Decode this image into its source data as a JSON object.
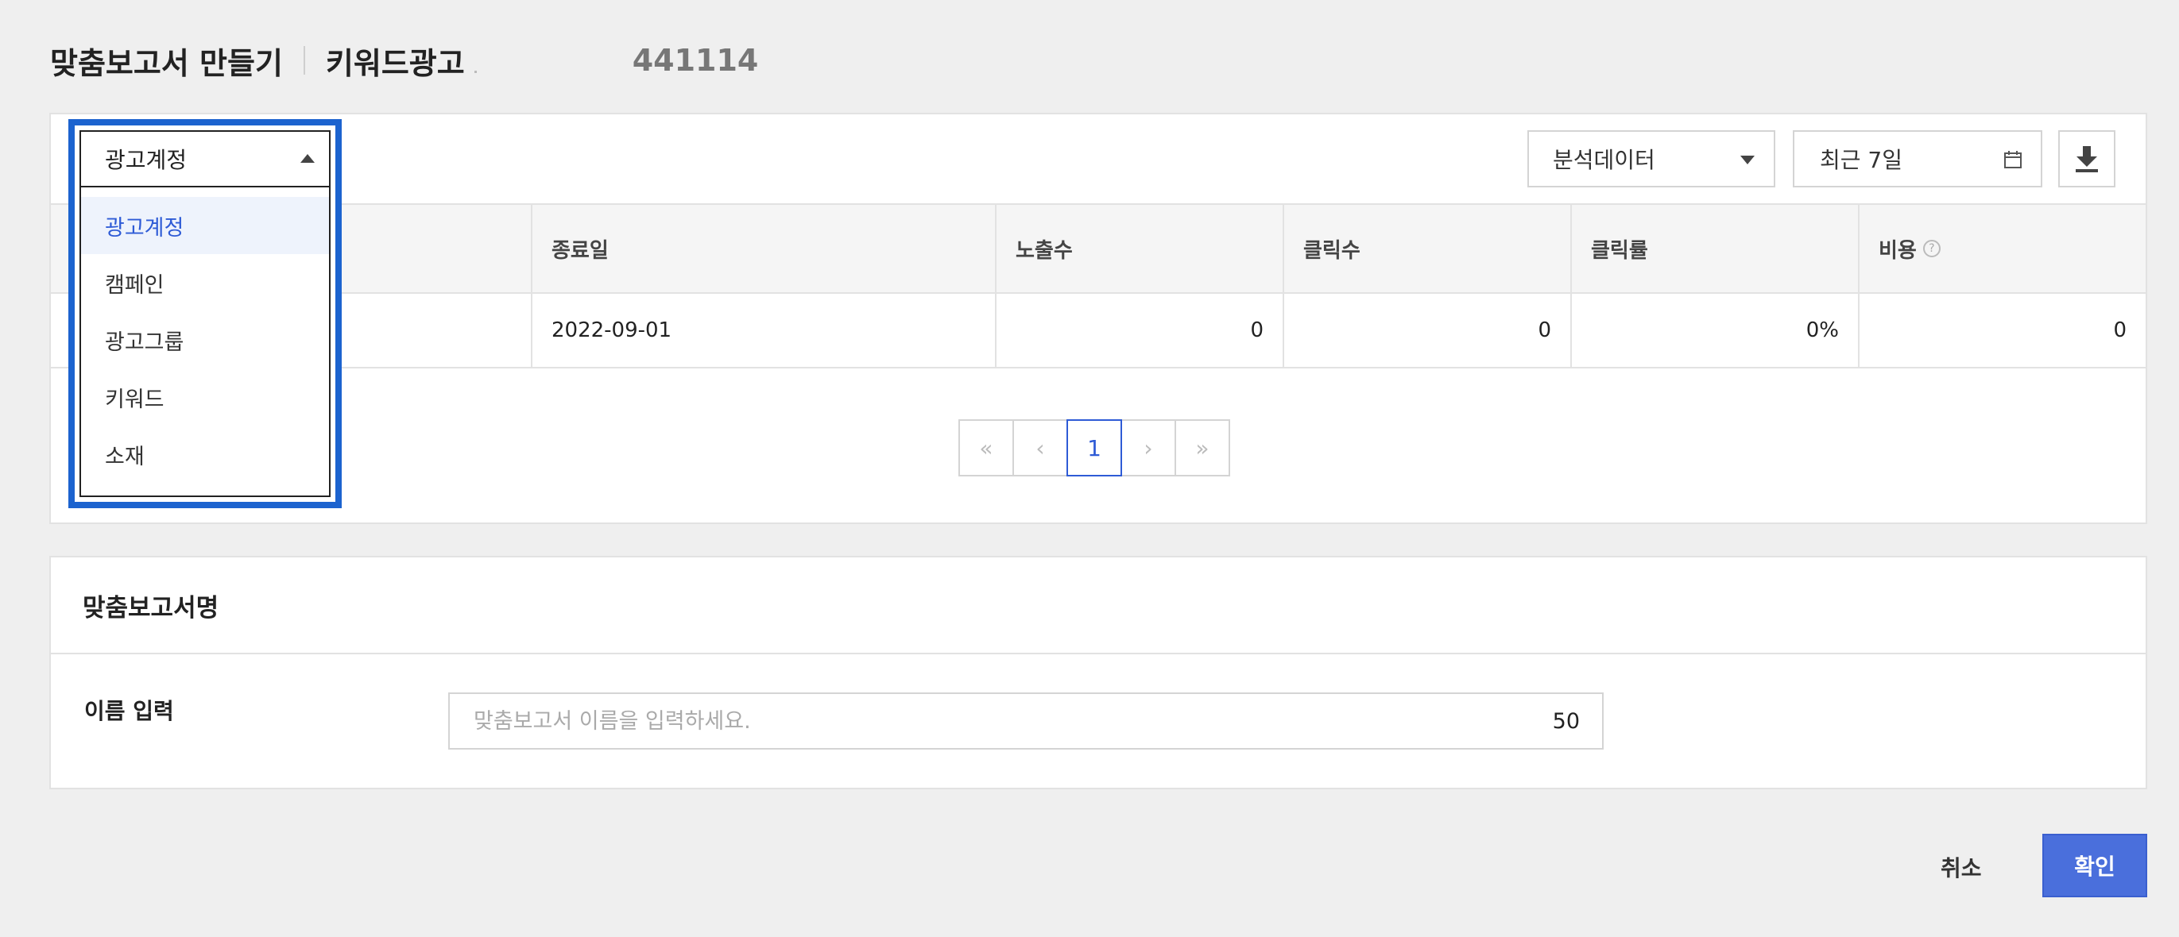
{
  "header": {
    "title": "맞춤보고서 만들기",
    "subtitle": "키워드광고",
    "account_id": "441114"
  },
  "toolbar": {
    "level_select": {
      "value": "광고계정",
      "options": [
        "광고계정",
        "캠페인",
        "광고그룹",
        "키워드",
        "소재"
      ]
    },
    "data_select": {
      "value": "분석데이터"
    },
    "date_range": {
      "value": "최근 7일"
    }
  },
  "table": {
    "headers": [
      "",
      "종료일",
      "노출수",
      "클릭수",
      "클릭률",
      "비용"
    ],
    "rows": [
      {
        "end_date": "2022-09-01",
        "impressions": "0",
        "clicks": "0",
        "ctr": "0%",
        "cost": "0"
      }
    ]
  },
  "pagination": {
    "first": "«",
    "prev": "‹",
    "current": "1",
    "next": "›",
    "last": "»"
  },
  "report_name": {
    "section_title": "맞춤보고서명",
    "field_label": "이름 입력",
    "placeholder": "맞춤보고서 이름을 입력하세요.",
    "value": "",
    "max_length": "50"
  },
  "actions": {
    "cancel": "취소",
    "confirm": "확인"
  },
  "colors": {
    "accent": "#2e5bd6",
    "dropdown_border": "#1c63cf",
    "confirm_bg": "#4a6fdc"
  }
}
